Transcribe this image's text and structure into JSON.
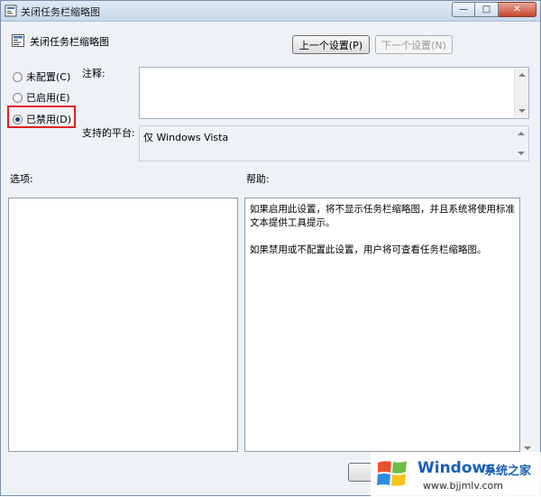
{
  "window": {
    "title": "关闭任务栏缩略图"
  },
  "header": {
    "policy_name": "关闭任务栏缩略图",
    "prev_button": "上一个设置(P)",
    "next_button": "下一个设置(N)"
  },
  "state": {
    "options": [
      {
        "label": "未配置(C)",
        "checked": false
      },
      {
        "label": "已启用(E)",
        "checked": false
      },
      {
        "label": "已禁用(D)",
        "checked": true
      }
    ]
  },
  "fields": {
    "comment_label": "注释:",
    "comment_value": "",
    "platform_label": "支持的平台:",
    "platform_value": "仅 Windows Vista"
  },
  "panels": {
    "options_label": "选项:",
    "help_label": "帮助:",
    "help_text": "如果启用此设置，将不显示任务栏缩略图，并且系统将使用标准文本提供工具提示。\n\n如果禁用或不配置此设置，用户将可查看任务栏缩略图。"
  },
  "watermark": {
    "brand": "Windows",
    "brand_cn": "系统之家",
    "url": "www.bjjmlv.com"
  },
  "colors": {
    "highlight": "#e02020",
    "close_button": "#c7452d",
    "watermark_blue": "#1a5fb4"
  }
}
